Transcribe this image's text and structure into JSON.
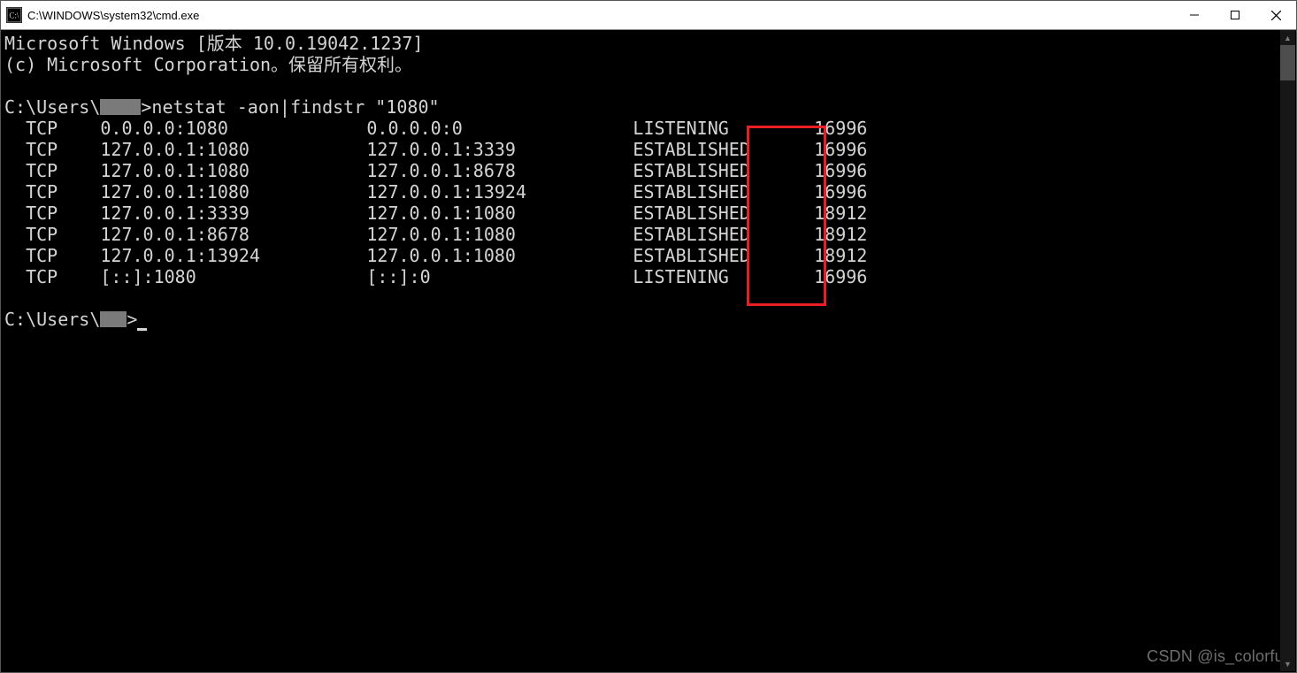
{
  "window": {
    "title": "C:\\WINDOWS\\system32\\cmd.exe"
  },
  "banner": {
    "line1": "Microsoft Windows [版本 10.0.19042.1237]",
    "line2": "(c) Microsoft Corporation。保留所有权利。"
  },
  "prompt": {
    "prefix": "C:\\Users\\",
    "suffix": ">",
    "command": "netstat -aon|findstr \"1080\""
  },
  "netstat": {
    "rows": [
      {
        "proto": "TCP",
        "local": "0.0.0.0:1080",
        "foreign": "0.0.0.0:0",
        "state": "LISTENING",
        "pid": "16996"
      },
      {
        "proto": "TCP",
        "local": "127.0.0.1:1080",
        "foreign": "127.0.0.1:3339",
        "state": "ESTABLISHED",
        "pid": "16996"
      },
      {
        "proto": "TCP",
        "local": "127.0.0.1:1080",
        "foreign": "127.0.0.1:8678",
        "state": "ESTABLISHED",
        "pid": "16996"
      },
      {
        "proto": "TCP",
        "local": "127.0.0.1:1080",
        "foreign": "127.0.0.1:13924",
        "state": "ESTABLISHED",
        "pid": "16996"
      },
      {
        "proto": "TCP",
        "local": "127.0.0.1:3339",
        "foreign": "127.0.0.1:1080",
        "state": "ESTABLISHED",
        "pid": "18912"
      },
      {
        "proto": "TCP",
        "local": "127.0.0.1:8678",
        "foreign": "127.0.0.1:1080",
        "state": "ESTABLISHED",
        "pid": "18912"
      },
      {
        "proto": "TCP",
        "local": "127.0.0.1:13924",
        "foreign": "127.0.0.1:1080",
        "state": "ESTABLISHED",
        "pid": "18912"
      },
      {
        "proto": "TCP",
        "local": "[::]:1080",
        "foreign": "[::]:0",
        "state": "LISTENING",
        "pid": "16996"
      }
    ]
  },
  "watermark": "CSDN @is_colorful"
}
